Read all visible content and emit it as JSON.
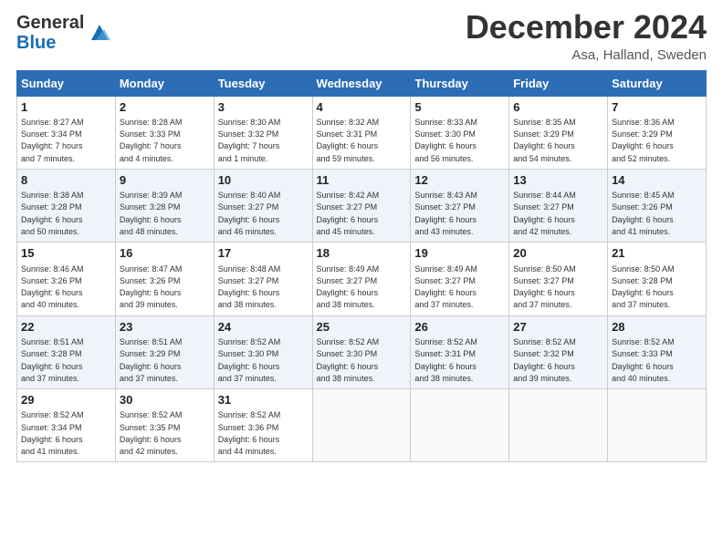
{
  "logo": {
    "general": "General",
    "blue": "Blue"
  },
  "header": {
    "month": "December 2024",
    "location": "Asa, Halland, Sweden"
  },
  "days_of_week": [
    "Sunday",
    "Monday",
    "Tuesday",
    "Wednesday",
    "Thursday",
    "Friday",
    "Saturday"
  ],
  "weeks": [
    [
      {
        "day": "1",
        "sunrise": "8:27 AM",
        "sunset": "3:34 PM",
        "daylight": "7 hours and 7 minutes."
      },
      {
        "day": "2",
        "sunrise": "8:28 AM",
        "sunset": "3:33 PM",
        "daylight": "7 hours and 4 minutes."
      },
      {
        "day": "3",
        "sunrise": "8:30 AM",
        "sunset": "3:32 PM",
        "daylight": "7 hours and 1 minute."
      },
      {
        "day": "4",
        "sunrise": "8:32 AM",
        "sunset": "3:31 PM",
        "daylight": "6 hours and 59 minutes."
      },
      {
        "day": "5",
        "sunrise": "8:33 AM",
        "sunset": "3:30 PM",
        "daylight": "6 hours and 56 minutes."
      },
      {
        "day": "6",
        "sunrise": "8:35 AM",
        "sunset": "3:29 PM",
        "daylight": "6 hours and 54 minutes."
      },
      {
        "day": "7",
        "sunrise": "8:36 AM",
        "sunset": "3:29 PM",
        "daylight": "6 hours and 52 minutes."
      }
    ],
    [
      {
        "day": "8",
        "sunrise": "8:38 AM",
        "sunset": "3:28 PM",
        "daylight": "6 hours and 50 minutes."
      },
      {
        "day": "9",
        "sunrise": "8:39 AM",
        "sunset": "3:28 PM",
        "daylight": "6 hours and 48 minutes."
      },
      {
        "day": "10",
        "sunrise": "8:40 AM",
        "sunset": "3:27 PM",
        "daylight": "6 hours and 46 minutes."
      },
      {
        "day": "11",
        "sunrise": "8:42 AM",
        "sunset": "3:27 PM",
        "daylight": "6 hours and 45 minutes."
      },
      {
        "day": "12",
        "sunrise": "8:43 AM",
        "sunset": "3:27 PM",
        "daylight": "6 hours and 43 minutes."
      },
      {
        "day": "13",
        "sunrise": "8:44 AM",
        "sunset": "3:27 PM",
        "daylight": "6 hours and 42 minutes."
      },
      {
        "day": "14",
        "sunrise": "8:45 AM",
        "sunset": "3:26 PM",
        "daylight": "6 hours and 41 minutes."
      }
    ],
    [
      {
        "day": "15",
        "sunrise": "8:46 AM",
        "sunset": "3:26 PM",
        "daylight": "6 hours and 40 minutes."
      },
      {
        "day": "16",
        "sunrise": "8:47 AM",
        "sunset": "3:26 PM",
        "daylight": "6 hours and 39 minutes."
      },
      {
        "day": "17",
        "sunrise": "8:48 AM",
        "sunset": "3:27 PM",
        "daylight": "6 hours and 38 minutes."
      },
      {
        "day": "18",
        "sunrise": "8:49 AM",
        "sunset": "3:27 PM",
        "daylight": "6 hours and 38 minutes."
      },
      {
        "day": "19",
        "sunrise": "8:49 AM",
        "sunset": "3:27 PM",
        "daylight": "6 hours and 37 minutes."
      },
      {
        "day": "20",
        "sunrise": "8:50 AM",
        "sunset": "3:27 PM",
        "daylight": "6 hours and 37 minutes."
      },
      {
        "day": "21",
        "sunrise": "8:50 AM",
        "sunset": "3:28 PM",
        "daylight": "6 hours and 37 minutes."
      }
    ],
    [
      {
        "day": "22",
        "sunrise": "8:51 AM",
        "sunset": "3:28 PM",
        "daylight": "6 hours and 37 minutes."
      },
      {
        "day": "23",
        "sunrise": "8:51 AM",
        "sunset": "3:29 PM",
        "daylight": "6 hours and 37 minutes."
      },
      {
        "day": "24",
        "sunrise": "8:52 AM",
        "sunset": "3:30 PM",
        "daylight": "6 hours and 37 minutes."
      },
      {
        "day": "25",
        "sunrise": "8:52 AM",
        "sunset": "3:30 PM",
        "daylight": "6 hours and 38 minutes."
      },
      {
        "day": "26",
        "sunrise": "8:52 AM",
        "sunset": "3:31 PM",
        "daylight": "6 hours and 38 minutes."
      },
      {
        "day": "27",
        "sunrise": "8:52 AM",
        "sunset": "3:32 PM",
        "daylight": "6 hours and 39 minutes."
      },
      {
        "day": "28",
        "sunrise": "8:52 AM",
        "sunset": "3:33 PM",
        "daylight": "6 hours and 40 minutes."
      }
    ],
    [
      {
        "day": "29",
        "sunrise": "8:52 AM",
        "sunset": "3:34 PM",
        "daylight": "6 hours and 41 minutes."
      },
      {
        "day": "30",
        "sunrise": "8:52 AM",
        "sunset": "3:35 PM",
        "daylight": "6 hours and 42 minutes."
      },
      {
        "day": "31",
        "sunrise": "8:52 AM",
        "sunset": "3:36 PM",
        "daylight": "6 hours and 44 minutes."
      },
      null,
      null,
      null,
      null
    ]
  ]
}
